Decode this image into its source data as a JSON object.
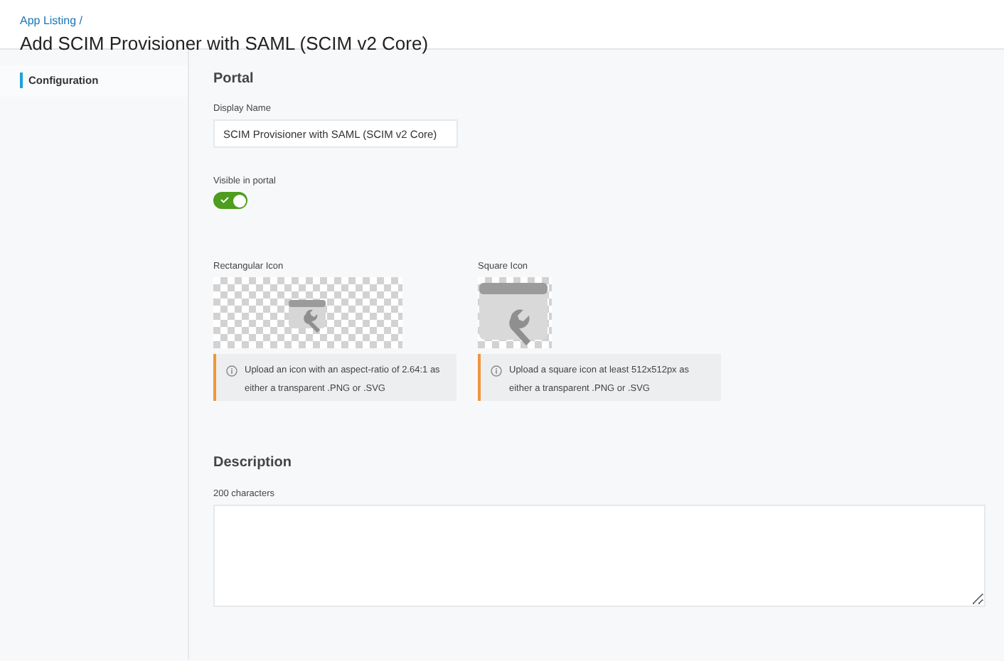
{
  "header": {
    "breadcrumb": "App Listing /",
    "title": "Add SCIM Provisioner with SAML (SCIM v2 Core)"
  },
  "sidebar": {
    "items": [
      {
        "label": "Configuration",
        "selected": true
      }
    ]
  },
  "portal": {
    "heading": "Portal",
    "display_name": {
      "label": "Display Name",
      "value": "SCIM Provisioner with SAML (SCIM v2 Core)"
    },
    "visible": {
      "label": "Visible in portal",
      "on": true
    },
    "icons": [
      {
        "kind": "rectangular",
        "label": "Rectangular Icon",
        "info": "Upload an icon with an aspect-ratio of 2.64:1 as either a transparent .PNG or .SVG"
      },
      {
        "kind": "square",
        "label": "Square Icon",
        "info": "Upload a square icon at least 512x512px as either a transparent .PNG or .SVG"
      }
    ]
  },
  "description": {
    "heading": "Description",
    "label": "200 characters"
  }
}
